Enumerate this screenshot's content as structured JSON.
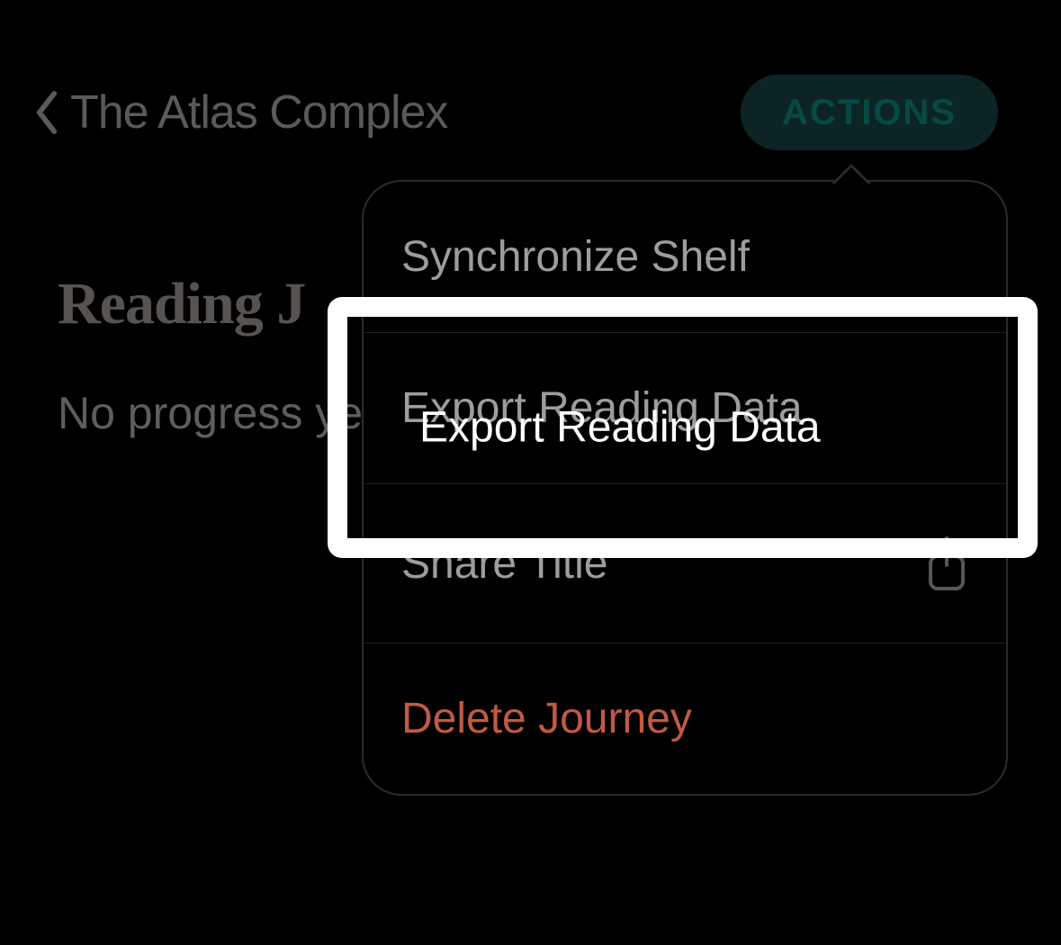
{
  "header": {
    "back_title": "The Atlas Complex",
    "actions_label": "ACTIONS"
  },
  "content": {
    "section_title": "Reading J",
    "progress_text": "No progress ye"
  },
  "menu": {
    "items": [
      {
        "label": "Synchronize Shelf",
        "type": "normal",
        "icon": null
      },
      {
        "label": "Export Reading Data",
        "type": "highlighted",
        "icon": null
      },
      {
        "label": "Share Title",
        "type": "normal",
        "icon": "share-icon"
      },
      {
        "label": "Delete Journey",
        "type": "danger",
        "icon": null
      }
    ]
  },
  "highlight": {
    "label": "Export Reading Data"
  }
}
